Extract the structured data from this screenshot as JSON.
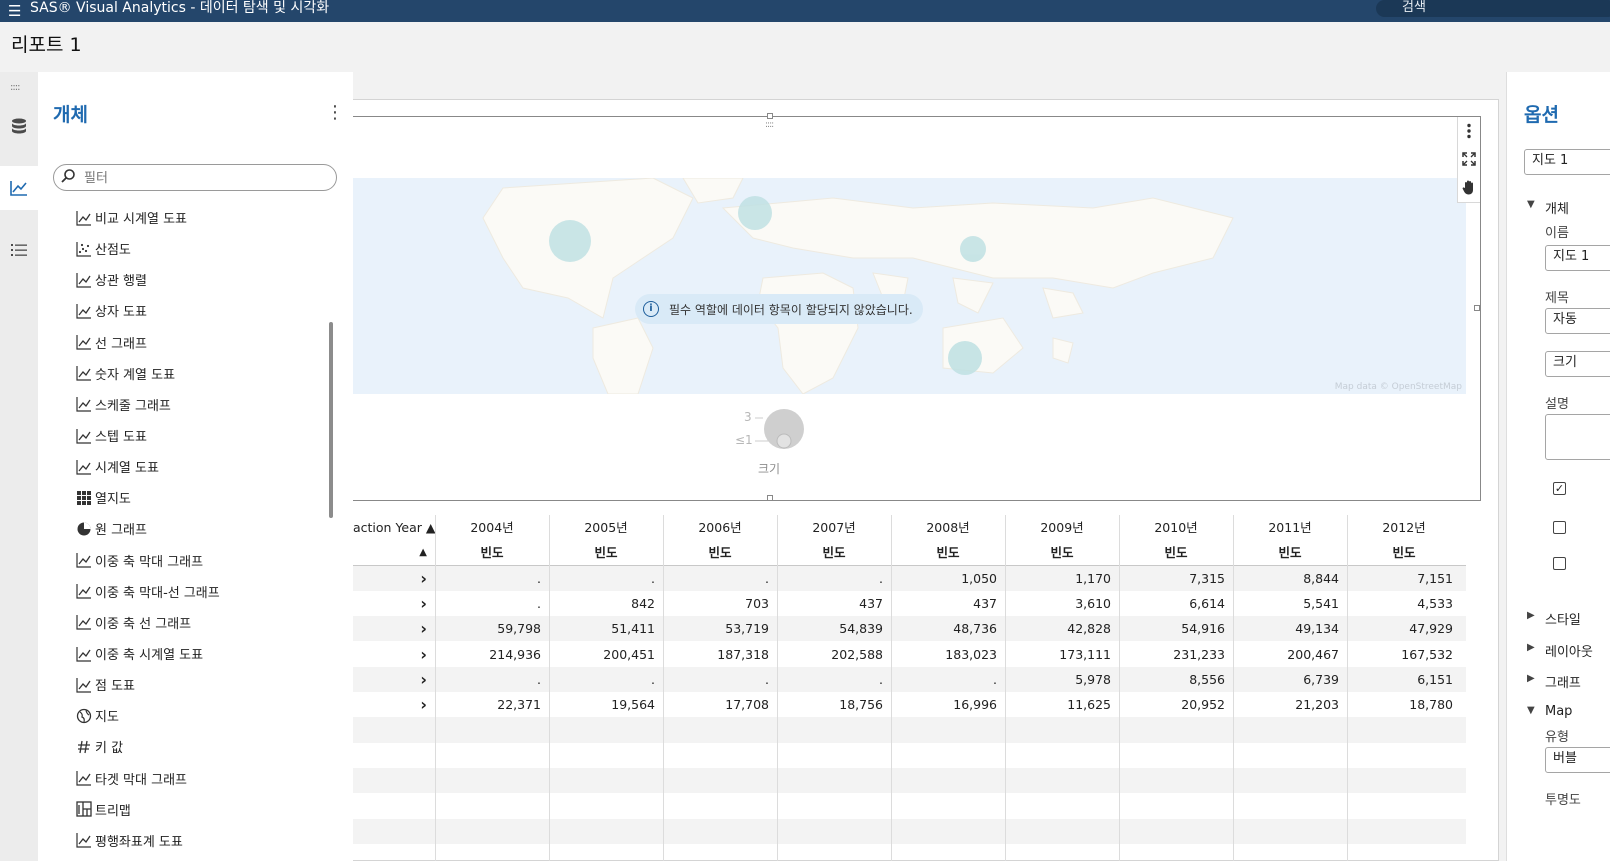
{
  "app": {
    "menu_icon": "hamburger-icon",
    "title": "SAS® Visual Analytics - 데이터 탐색 및 시각화",
    "search_label": "검색"
  },
  "report": {
    "title": "리포트 1"
  },
  "left_rail": {
    "items": [
      {
        "icon": "database-icon",
        "active": false
      },
      {
        "icon": "line-chart-icon",
        "active": true
      },
      {
        "icon": "outline-list-icon",
        "active": false
      }
    ]
  },
  "objects_panel": {
    "title": "개체",
    "filter_placeholder": "필터",
    "items": [
      {
        "label": "비교 시계열 도표",
        "icon": "comparative-time-series-icon"
      },
      {
        "label": "산점도",
        "icon": "scatter-plot-icon"
      },
      {
        "label": "상관 행렬",
        "icon": "correlation-matrix-icon"
      },
      {
        "label": "상자 도표",
        "icon": "box-plot-icon"
      },
      {
        "label": "선 그래프",
        "icon": "line-chart-icon"
      },
      {
        "label": "숫자 계열 도표",
        "icon": "numeric-series-icon"
      },
      {
        "label": "스케줄 그래프",
        "icon": "schedule-chart-icon"
      },
      {
        "label": "스텝 도표",
        "icon": "step-plot-icon"
      },
      {
        "label": "시계열 도표",
        "icon": "time-series-icon"
      },
      {
        "label": "열지도",
        "icon": "heat-map-icon"
      },
      {
        "label": "원 그래프",
        "icon": "pie-chart-icon"
      },
      {
        "label": "이중 축 막대 그래프",
        "icon": "dual-axis-bar-icon"
      },
      {
        "label": "이중 축 막대-선 그래프",
        "icon": "dual-axis-bar-line-icon"
      },
      {
        "label": "이중 축 선 그래프",
        "icon": "dual-axis-line-icon"
      },
      {
        "label": "이중 축 시계열 도표",
        "icon": "dual-axis-time-series-icon"
      },
      {
        "label": "점 도표",
        "icon": "dot-plot-icon"
      },
      {
        "label": "지도",
        "icon": "globe-icon"
      },
      {
        "label": "키 값",
        "icon": "hash-icon"
      },
      {
        "label": "타겟 막대 그래프",
        "icon": "targeted-bar-icon"
      },
      {
        "label": "트리맵",
        "icon": "treemap-icon"
      },
      {
        "label": "평행좌표계 도표",
        "icon": "parallel-coordinates-icon"
      }
    ]
  },
  "map": {
    "message": "필수 역할에 데이터 항목이 할당되지 않았습니다.",
    "attribution": "Map data © OpenStreetMap",
    "legend": {
      "title": "크기",
      "max_label": "3",
      "min_label": "≤1"
    },
    "toolbar_icons": [
      "more-options-icon",
      "maximize-icon",
      "pan-hand-icon"
    ],
    "bubble_color": "#bfe1e3"
  },
  "crosstab": {
    "row_header_label": "action Year ▲",
    "measure_sort": "▲",
    "years": [
      "2004년",
      "2005년",
      "2006년",
      "2007년",
      "2008년",
      "2009년",
      "2010년",
      "2011년",
      "2012년"
    ],
    "measure": "빈도",
    "rows": [
      [
        ".",
        ".",
        ".",
        ".",
        "1,050",
        "1,170",
        "7,315",
        "8,844",
        "7,151"
      ],
      [
        ".",
        "842",
        "703",
        "437",
        "437",
        "3,610",
        "6,614",
        "5,541",
        "4,533"
      ],
      [
        "59,798",
        "51,411",
        "53,719",
        "54,839",
        "48,736",
        "42,828",
        "54,916",
        "49,134",
        "47,929"
      ],
      [
        "214,936",
        "200,451",
        "187,318",
        "202,588",
        "183,023",
        "173,111",
        "231,233",
        "200,467",
        "167,532"
      ],
      [
        ".",
        ".",
        ".",
        ".",
        ".",
        "5,978",
        "8,556",
        "6,739",
        "6,151"
      ],
      [
        "22,371",
        "19,564",
        "17,708",
        "18,756",
        "16,996",
        "11,625",
        "20,952",
        "21,203",
        "18,780"
      ]
    ],
    "expand_icon": "chevron-right-icon"
  },
  "options_panel": {
    "title": "옵션",
    "object_select": "지도 1",
    "sections": {
      "object": "개체",
      "name_label": "이름",
      "name_value": "지도 1",
      "title_label": "제목",
      "title_value": "자동",
      "size_value": "크기",
      "desc_label": "설명",
      "style": "스타일",
      "layout": "레이아웃",
      "graph": "그래프",
      "map": "Map",
      "type_label": "유형",
      "type_value": "버블",
      "transparency_label": "투명도"
    },
    "checkboxes": [
      true,
      false,
      false
    ]
  }
}
